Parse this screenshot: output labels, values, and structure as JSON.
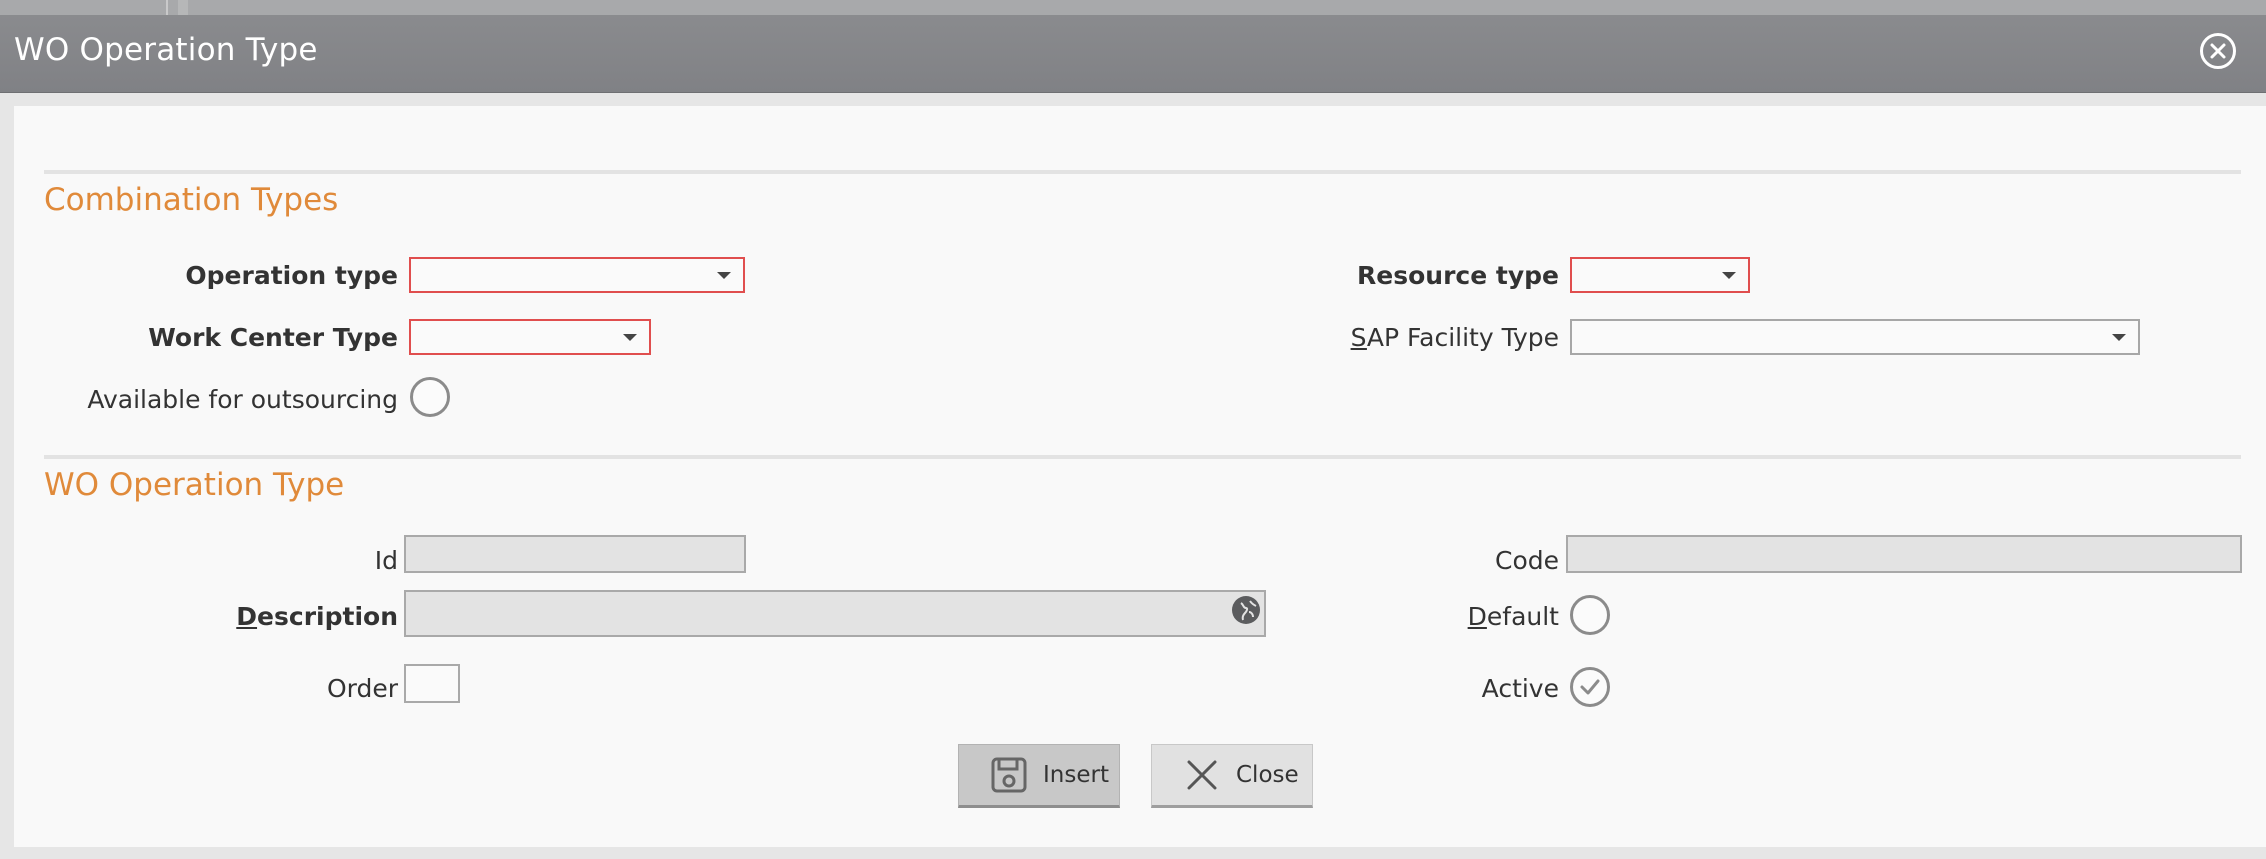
{
  "dialog": {
    "title": "WO Operation Type",
    "close_icon": "close-circle-icon"
  },
  "section1": {
    "title": "Combination Types",
    "operation_type_label": "Operation type",
    "resource_type_label": "Resource type",
    "work_center_type_label": "Work Center Type",
    "sap_facility_label_u": "S",
    "sap_facility_label_rest": "AP Facility Type",
    "available_outsourcing_label": "Available for outsourcing"
  },
  "section2": {
    "title": "WO Operation Type",
    "id_label": "Id",
    "code_label": "Code",
    "description_label_u": "D",
    "description_label_rest": "escription",
    "default_label_u": "D",
    "default_label_rest": "efault",
    "order_label": "Order",
    "active_label": "Active",
    "globe_icon": "globe-icon"
  },
  "buttons": {
    "insert_label": "Insert",
    "close_label": "Close"
  },
  "colors": {
    "accent": "#e08a3a",
    "required_border": "#e04e4e",
    "titlebar": "#858689"
  }
}
